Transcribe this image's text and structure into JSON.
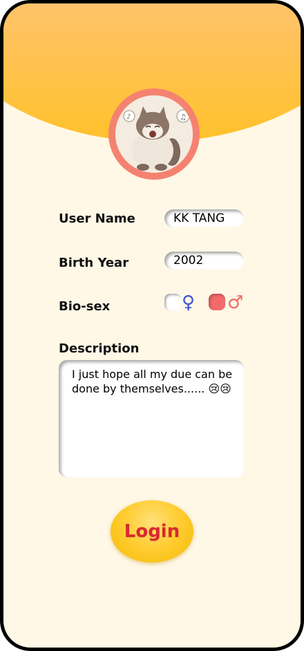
{
  "form": {
    "username_label": "User Name",
    "username_value": "KK TANG",
    "birthyear_label": "Birth Year",
    "birthyear_value": "2002",
    "biosex_label": "Bio-sex",
    "female_symbol": "♀",
    "male_symbol": "♂",
    "selected_sex": "male",
    "description_label": "Description",
    "description_value": "I just hope all my due can be done by themselves...... 😢😢"
  },
  "login_button": {
    "label": "Login"
  },
  "colors": {
    "header_top": "#ffc27c",
    "header_bottom": "#ffc12a",
    "background": "#fff8e6",
    "avatar_ring": "#f58270",
    "female_symbol": "#3c54d6",
    "male_symbol": "#ef6a6a",
    "radio_selected": "#f26b6b",
    "login_text": "#d9282f",
    "login_fill": "#ffce35"
  },
  "icons": {
    "avatar": "cat-avatar-image",
    "female": "female-symbol-icon",
    "male": "male-symbol-icon"
  }
}
